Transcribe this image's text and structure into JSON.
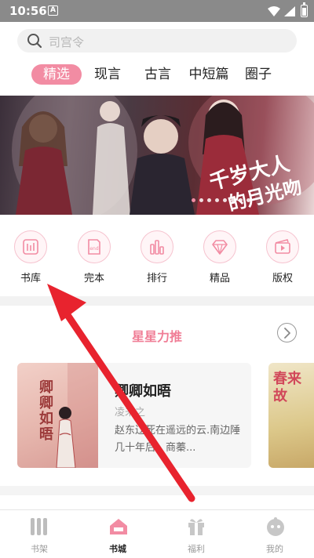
{
  "status_bar": {
    "time": "10:56",
    "notification_letter": "A",
    "icons": [
      "wifi-icon",
      "signal-icon",
      "battery-icon"
    ]
  },
  "search": {
    "placeholder": "司宫令"
  },
  "tabs": [
    {
      "label": "精选",
      "active": true
    },
    {
      "label": "现言",
      "active": false
    },
    {
      "label": "古言",
      "active": false
    },
    {
      "label": "中短篇",
      "active": false
    },
    {
      "label": "圈子",
      "active": false
    }
  ],
  "banner": {
    "slide_count": 8,
    "active_slide": 0
  },
  "categories": [
    {
      "label": "书库",
      "icon": "library-icon"
    },
    {
      "label": "完本",
      "icon": "completed-book-icon"
    },
    {
      "label": "排行",
      "icon": "ranking-icon"
    },
    {
      "label": "精品",
      "icon": "diamond-icon"
    },
    {
      "label": "版权",
      "icon": "copyright-film-icon"
    }
  ],
  "recommend": {
    "title": "星星力推",
    "books": [
      {
        "title": "卿卿如晤",
        "author": "凌未之",
        "description": "赵东辽死在遥远的云.南边陲几十年后，商蓁...",
        "cover_text": "卿卿如晤"
      },
      {
        "title": "",
        "author": "",
        "description": "",
        "cover_text": "春来故"
      }
    ]
  },
  "bottom_nav": [
    {
      "label": "书架",
      "icon": "bookshelf-icon",
      "active": false
    },
    {
      "label": "书城",
      "icon": "bookstore-icon",
      "active": true
    },
    {
      "label": "福利",
      "icon": "gift-icon",
      "active": false
    },
    {
      "label": "我的",
      "icon": "profile-icon",
      "active": false
    }
  ],
  "colors": {
    "accent": "#f28ca3",
    "section_title": "#f07e96",
    "annotation_arrow": "#e8232e"
  }
}
